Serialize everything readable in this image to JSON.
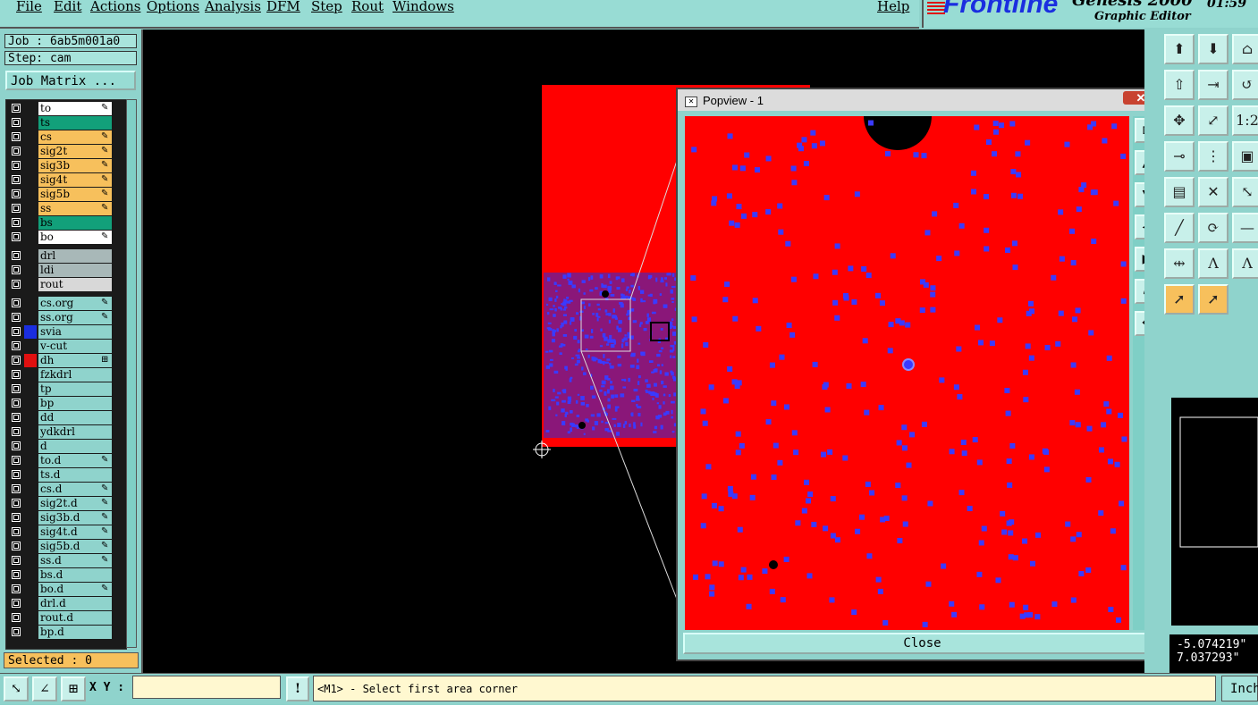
{
  "menu": {
    "items": [
      "File",
      "Edit",
      "Actions",
      "Options",
      "Analysis",
      "DFM",
      "Step",
      "Rout",
      "Windows"
    ],
    "help": "Help"
  },
  "brand": {
    "logo": "Frontline",
    "app_name": "Genesis 2000",
    "subtitle": "Graphic Editor",
    "clock": "01:59"
  },
  "job": {
    "job_label": "Job : 6ab5m001a0",
    "step_label": "Step: cam",
    "matrix_button": "Job Matrix ...",
    "selected": "Selected : 0"
  },
  "layers": [
    {
      "name": "to",
      "bg": "#ffffff",
      "swatch": "",
      "mark": "✎"
    },
    {
      "name": "ts",
      "bg": "#12a07a",
      "swatch": "",
      "mark": ""
    },
    {
      "name": "cs",
      "bg": "#f7c05c",
      "swatch": "",
      "mark": "✎"
    },
    {
      "name": "sig2t",
      "bg": "#f7c05c",
      "swatch": "",
      "mark": "✎"
    },
    {
      "name": "sig3b",
      "bg": "#f7c05c",
      "swatch": "",
      "mark": "✎"
    },
    {
      "name": "sig4t",
      "bg": "#f7c05c",
      "swatch": "",
      "mark": "✎"
    },
    {
      "name": "sig5b",
      "bg": "#f7c05c",
      "swatch": "",
      "mark": "✎"
    },
    {
      "name": "ss",
      "bg": "#f7c05c",
      "swatch": "",
      "mark": "✎"
    },
    {
      "name": "bs",
      "bg": "#12a07a",
      "swatch": "",
      "mark": ""
    },
    {
      "name": "bo",
      "bg": "#ffffff",
      "swatch": "",
      "mark": "✎"
    },
    {
      "name": "drl",
      "bg": "#a8b8b8",
      "swatch": "",
      "mark": "",
      "gap": true
    },
    {
      "name": "ldi",
      "bg": "#a8b8b8",
      "swatch": "",
      "mark": ""
    },
    {
      "name": "rout",
      "bg": "#d8d8d8",
      "swatch": "",
      "mark": ""
    },
    {
      "name": "cs.org",
      "bg": "#8fd3cc",
      "swatch": "",
      "mark": "✎",
      "gap": true
    },
    {
      "name": "ss.org",
      "bg": "#8fd3cc",
      "swatch": "",
      "mark": "✎"
    },
    {
      "name": "svia",
      "bg": "#8fd3cc",
      "swatch": "#1a2ee0",
      "mark": ""
    },
    {
      "name": "v-cut",
      "bg": "#8fd3cc",
      "swatch": "",
      "mark": ""
    },
    {
      "name": "dh",
      "bg": "#8fd3cc",
      "swatch": "#e01010",
      "mark": "⊞"
    },
    {
      "name": "fzkdrl",
      "bg": "#8fd3cc",
      "swatch": "",
      "mark": ""
    },
    {
      "name": "tp",
      "bg": "#8fd3cc",
      "swatch": "",
      "mark": ""
    },
    {
      "name": "bp",
      "bg": "#8fd3cc",
      "swatch": "",
      "mark": ""
    },
    {
      "name": "dd",
      "bg": "#8fd3cc",
      "swatch": "",
      "mark": ""
    },
    {
      "name": "ydkdrl",
      "bg": "#8fd3cc",
      "swatch": "",
      "mark": ""
    },
    {
      "name": "d",
      "bg": "#8fd3cc",
      "swatch": "",
      "mark": ""
    },
    {
      "name": "to.d",
      "bg": "#8fd3cc",
      "swatch": "",
      "mark": "✎"
    },
    {
      "name": "ts.d",
      "bg": "#8fd3cc",
      "swatch": "",
      "mark": ""
    },
    {
      "name": "cs.d",
      "bg": "#8fd3cc",
      "swatch": "",
      "mark": "✎"
    },
    {
      "name": "sig2t.d",
      "bg": "#8fd3cc",
      "swatch": "",
      "mark": "✎"
    },
    {
      "name": "sig3b.d",
      "bg": "#8fd3cc",
      "swatch": "",
      "mark": "✎"
    },
    {
      "name": "sig4t.d",
      "bg": "#8fd3cc",
      "swatch": "",
      "mark": "✎"
    },
    {
      "name": "sig5b.d",
      "bg": "#8fd3cc",
      "swatch": "",
      "mark": "✎"
    },
    {
      "name": "ss.d",
      "bg": "#8fd3cc",
      "swatch": "",
      "mark": "✎"
    },
    {
      "name": "bs.d",
      "bg": "#8fd3cc",
      "swatch": "",
      "mark": ""
    },
    {
      "name": "bo.d",
      "bg": "#8fd3cc",
      "swatch": "",
      "mark": "✎"
    },
    {
      "name": "drl.d",
      "bg": "#8fd3cc",
      "swatch": "",
      "mark": ""
    },
    {
      "name": "rout.d",
      "bg": "#8fd3cc",
      "swatch": "",
      "mark": ""
    },
    {
      "name": "bp.d",
      "bg": "#8fd3cc",
      "swatch": "",
      "mark": ""
    }
  ],
  "popview": {
    "title": "Popview - 1",
    "close_x": "✕",
    "close_button": "Close",
    "tool_icons": [
      "zoom-home-icon",
      "zoom-in-icon",
      "zoom-out-icon",
      "pan-left-icon",
      "pan-right-icon",
      "fit-icon",
      "center-icon"
    ]
  },
  "right_tools": {
    "icons": [
      "home-icon",
      "load-icon",
      "house-icon",
      "up-arrow-icon",
      "export-icon",
      "undo-icon",
      "move-icon",
      "fit-icon",
      "scale-1-2-icon",
      "probe-icon",
      "net-icon",
      "zoom-area-icon",
      "ruler-icon",
      "cross-icon",
      "connect-icon",
      "line-icon",
      "arc-icon",
      "minus-icon",
      "dimension-icon",
      "pad-icon",
      "surface-icon",
      "select-icon",
      "pointer-icon"
    ],
    "coord_x": "-5.074219\"",
    "coord_y": "7.037293\""
  },
  "bottom": {
    "xy_label": "X Y :",
    "xy_value": "",
    "alert": "!",
    "status": "<M1> - Select first area corner",
    "units": "Inch"
  }
}
